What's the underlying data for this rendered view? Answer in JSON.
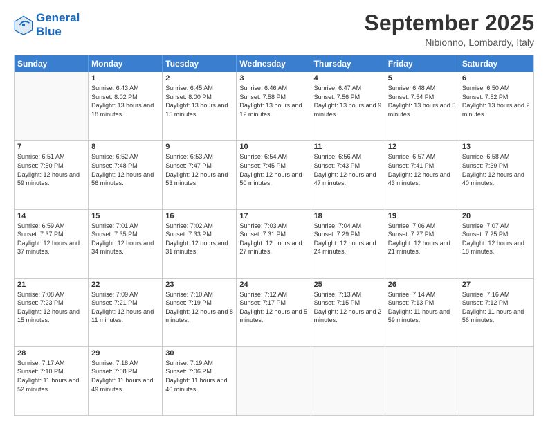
{
  "header": {
    "logo_line1": "General",
    "logo_line2": "Blue",
    "month": "September 2025",
    "location": "Nibionno, Lombardy, Italy"
  },
  "weekdays": [
    "Sunday",
    "Monday",
    "Tuesday",
    "Wednesday",
    "Thursday",
    "Friday",
    "Saturday"
  ],
  "rows": [
    [
      {
        "day": "",
        "sunrise": "",
        "sunset": "",
        "daylight": ""
      },
      {
        "day": "1",
        "sunrise": "Sunrise: 6:43 AM",
        "sunset": "Sunset: 8:02 PM",
        "daylight": "Daylight: 13 hours and 18 minutes."
      },
      {
        "day": "2",
        "sunrise": "Sunrise: 6:45 AM",
        "sunset": "Sunset: 8:00 PM",
        "daylight": "Daylight: 13 hours and 15 minutes."
      },
      {
        "day": "3",
        "sunrise": "Sunrise: 6:46 AM",
        "sunset": "Sunset: 7:58 PM",
        "daylight": "Daylight: 13 hours and 12 minutes."
      },
      {
        "day": "4",
        "sunrise": "Sunrise: 6:47 AM",
        "sunset": "Sunset: 7:56 PM",
        "daylight": "Daylight: 13 hours and 9 minutes."
      },
      {
        "day": "5",
        "sunrise": "Sunrise: 6:48 AM",
        "sunset": "Sunset: 7:54 PM",
        "daylight": "Daylight: 13 hours and 5 minutes."
      },
      {
        "day": "6",
        "sunrise": "Sunrise: 6:50 AM",
        "sunset": "Sunset: 7:52 PM",
        "daylight": "Daylight: 13 hours and 2 minutes."
      }
    ],
    [
      {
        "day": "7",
        "sunrise": "Sunrise: 6:51 AM",
        "sunset": "Sunset: 7:50 PM",
        "daylight": "Daylight: 12 hours and 59 minutes."
      },
      {
        "day": "8",
        "sunrise": "Sunrise: 6:52 AM",
        "sunset": "Sunset: 7:48 PM",
        "daylight": "Daylight: 12 hours and 56 minutes."
      },
      {
        "day": "9",
        "sunrise": "Sunrise: 6:53 AM",
        "sunset": "Sunset: 7:47 PM",
        "daylight": "Daylight: 12 hours and 53 minutes."
      },
      {
        "day": "10",
        "sunrise": "Sunrise: 6:54 AM",
        "sunset": "Sunset: 7:45 PM",
        "daylight": "Daylight: 12 hours and 50 minutes."
      },
      {
        "day": "11",
        "sunrise": "Sunrise: 6:56 AM",
        "sunset": "Sunset: 7:43 PM",
        "daylight": "Daylight: 12 hours and 47 minutes."
      },
      {
        "day": "12",
        "sunrise": "Sunrise: 6:57 AM",
        "sunset": "Sunset: 7:41 PM",
        "daylight": "Daylight: 12 hours and 43 minutes."
      },
      {
        "day": "13",
        "sunrise": "Sunrise: 6:58 AM",
        "sunset": "Sunset: 7:39 PM",
        "daylight": "Daylight: 12 hours and 40 minutes."
      }
    ],
    [
      {
        "day": "14",
        "sunrise": "Sunrise: 6:59 AM",
        "sunset": "Sunset: 7:37 PM",
        "daylight": "Daylight: 12 hours and 37 minutes."
      },
      {
        "day": "15",
        "sunrise": "Sunrise: 7:01 AM",
        "sunset": "Sunset: 7:35 PM",
        "daylight": "Daylight: 12 hours and 34 minutes."
      },
      {
        "day": "16",
        "sunrise": "Sunrise: 7:02 AM",
        "sunset": "Sunset: 7:33 PM",
        "daylight": "Daylight: 12 hours and 31 minutes."
      },
      {
        "day": "17",
        "sunrise": "Sunrise: 7:03 AM",
        "sunset": "Sunset: 7:31 PM",
        "daylight": "Daylight: 12 hours and 27 minutes."
      },
      {
        "day": "18",
        "sunrise": "Sunrise: 7:04 AM",
        "sunset": "Sunset: 7:29 PM",
        "daylight": "Daylight: 12 hours and 24 minutes."
      },
      {
        "day": "19",
        "sunrise": "Sunrise: 7:06 AM",
        "sunset": "Sunset: 7:27 PM",
        "daylight": "Daylight: 12 hours and 21 minutes."
      },
      {
        "day": "20",
        "sunrise": "Sunrise: 7:07 AM",
        "sunset": "Sunset: 7:25 PM",
        "daylight": "Daylight: 12 hours and 18 minutes."
      }
    ],
    [
      {
        "day": "21",
        "sunrise": "Sunrise: 7:08 AM",
        "sunset": "Sunset: 7:23 PM",
        "daylight": "Daylight: 12 hours and 15 minutes."
      },
      {
        "day": "22",
        "sunrise": "Sunrise: 7:09 AM",
        "sunset": "Sunset: 7:21 PM",
        "daylight": "Daylight: 12 hours and 11 minutes."
      },
      {
        "day": "23",
        "sunrise": "Sunrise: 7:10 AM",
        "sunset": "Sunset: 7:19 PM",
        "daylight": "Daylight: 12 hours and 8 minutes."
      },
      {
        "day": "24",
        "sunrise": "Sunrise: 7:12 AM",
        "sunset": "Sunset: 7:17 PM",
        "daylight": "Daylight: 12 hours and 5 minutes."
      },
      {
        "day": "25",
        "sunrise": "Sunrise: 7:13 AM",
        "sunset": "Sunset: 7:15 PM",
        "daylight": "Daylight: 12 hours and 2 minutes."
      },
      {
        "day": "26",
        "sunrise": "Sunrise: 7:14 AM",
        "sunset": "Sunset: 7:13 PM",
        "daylight": "Daylight: 11 hours and 59 minutes."
      },
      {
        "day": "27",
        "sunrise": "Sunrise: 7:16 AM",
        "sunset": "Sunset: 7:12 PM",
        "daylight": "Daylight: 11 hours and 56 minutes."
      }
    ],
    [
      {
        "day": "28",
        "sunrise": "Sunrise: 7:17 AM",
        "sunset": "Sunset: 7:10 PM",
        "daylight": "Daylight: 11 hours and 52 minutes."
      },
      {
        "day": "29",
        "sunrise": "Sunrise: 7:18 AM",
        "sunset": "Sunset: 7:08 PM",
        "daylight": "Daylight: 11 hours and 49 minutes."
      },
      {
        "day": "30",
        "sunrise": "Sunrise: 7:19 AM",
        "sunset": "Sunset: 7:06 PM",
        "daylight": "Daylight: 11 hours and 46 minutes."
      },
      {
        "day": "",
        "sunrise": "",
        "sunset": "",
        "daylight": ""
      },
      {
        "day": "",
        "sunrise": "",
        "sunset": "",
        "daylight": ""
      },
      {
        "day": "",
        "sunrise": "",
        "sunset": "",
        "daylight": ""
      },
      {
        "day": "",
        "sunrise": "",
        "sunset": "",
        "daylight": ""
      }
    ]
  ]
}
